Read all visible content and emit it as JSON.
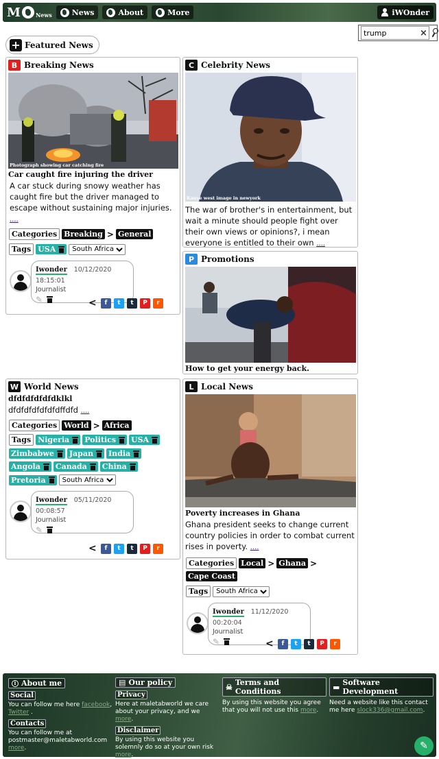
{
  "nav": {
    "logo_letter": "M",
    "logo_sub": "News",
    "items": [
      {
        "label": "News",
        "icon": "globe-icon"
      },
      {
        "label": "About",
        "icon": "globe-icon"
      },
      {
        "label": "More",
        "icon": "globe-icon"
      }
    ],
    "user": "iWOnder"
  },
  "search": {
    "value": "trump"
  },
  "featured": {
    "label": "Featured News"
  },
  "cards": {
    "breaking": {
      "letter": "B",
      "letter_color": "#e0201e",
      "section": "Breaking News",
      "caption": "Photograph showing car catching fire",
      "title": "Car caught fire injuring the driver",
      "summary": "A car stuck during snowy weather has caught fire but the driver managed to escape without sustaining major injuries.",
      "more": "....",
      "categories_label": "Categories",
      "categories": [
        "Breaking",
        "General"
      ],
      "tags_label": "Tags",
      "tags": [
        "USA"
      ],
      "tag_select": "South Africa",
      "author": {
        "name": "Iwonder",
        "date": "10/12/2020 18:15:01",
        "role": "Journalist"
      }
    },
    "celebrity": {
      "letter": "C",
      "letter_color": "#111111",
      "section": "Celebrity News",
      "caption": "Kanye west image in newyork",
      "summary": "The war of brother's in entertainment, but wait a minute should people fight over their own views or opinions?, i mean everyone is entitled to their own",
      "more": "...."
    },
    "promotions": {
      "letter": "P",
      "letter_color": "#2a8ae0",
      "section": "Promotions",
      "title": "How to get your energy back."
    },
    "world": {
      "letter": "W",
      "letter_color": "#111111",
      "section": "World News",
      "title": "dfdfdfdfdfdklkl",
      "summary": "dfdfdfdfdfdfdffdfd",
      "more": "....",
      "categories_label": "Categories",
      "categories": [
        "World",
        "Africa"
      ],
      "tags_label": "Tags",
      "tags": [
        "Nigeria",
        "Politics",
        "USA",
        "Zimbabwe",
        "Japan",
        "India",
        "Angola",
        "Canada",
        "China",
        "Pretoria"
      ],
      "tag_select": "South Africa",
      "author": {
        "name": "Iwonder",
        "date": "05/11/2020 00:08:57",
        "role": "Journalist"
      }
    },
    "local": {
      "letter": "L",
      "letter_color": "#111111",
      "section": "Local News",
      "title": "Poverty increases in Ghana",
      "summary": "Ghana president seeks to change current country policies in order to combat current rises in poverty.",
      "more": "....",
      "categories_label": "Categories",
      "categories": [
        "Local",
        "Ghana",
        "Cape Coast"
      ],
      "tags_label": "Tags",
      "tag_select": "South Africa",
      "author": {
        "name": "Iwonder",
        "date": "11/12/2020 00:20:04",
        "role": "Journalist"
      }
    }
  },
  "share": [
    {
      "name": "share-icon"
    },
    {
      "name": "facebook-icon",
      "glyph": "f",
      "color": "#3b5998"
    },
    {
      "name": "twitter-icon",
      "glyph": "t",
      "color": "#1da1f2"
    },
    {
      "name": "tumblr-icon",
      "glyph": "t",
      "color": "#1a2a3a"
    },
    {
      "name": "pinterest-icon",
      "glyph": "P",
      "color": "#e0201e"
    },
    {
      "name": "reddit-icon",
      "glyph": "r",
      "color": "#ff5700"
    }
  ],
  "footer": {
    "about": {
      "head": "About me",
      "social_label": "Social",
      "social_text": "You can follow me here",
      "social_links": [
        "facebook",
        "Twitter"
      ],
      "contacts_label": "Contacts",
      "contacts_text": "You can follow me at postmaster@maletabworld.com",
      "contacts_more": "more"
    },
    "policy": {
      "head": "Our policy",
      "privacy_label": "Privacy",
      "privacy_text": "Here at maletabworld we care about your privacy, and we",
      "privacy_more": "more",
      "disclaimer_label": "Disclaimer",
      "disclaimer_text": "By using this website you solemnly do so at your own risk",
      "disclaimer_more": "more"
    },
    "terms": {
      "head": "Terms and Conditions",
      "text": "By using this website you agree that you will not use this",
      "more": "more"
    },
    "software": {
      "head": "Software Development",
      "text": "Need a website like this contact me here",
      "link": "slock336@gmail.com"
    }
  }
}
